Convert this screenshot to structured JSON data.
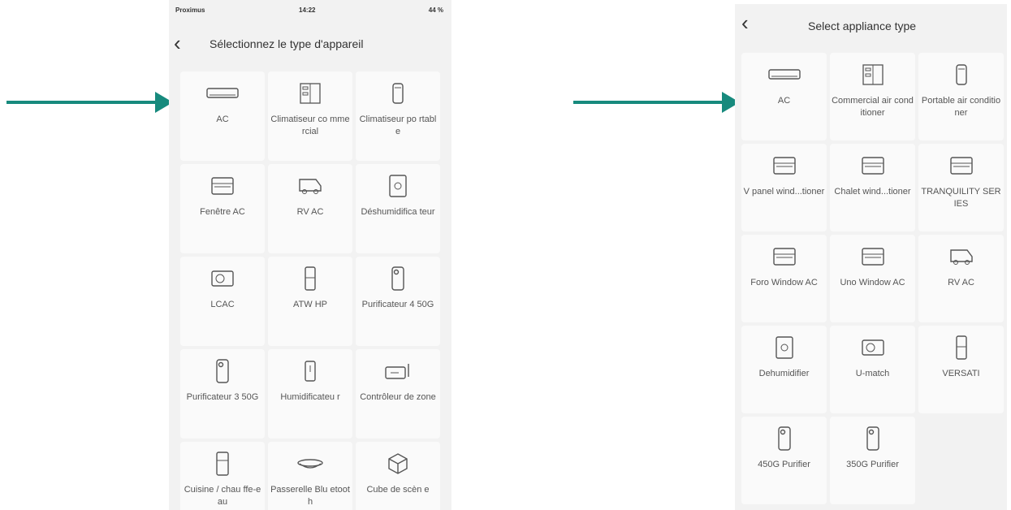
{
  "colors": {
    "arrow": "#178a7d",
    "panel_bg": "#f2f2f2",
    "tile_bg": "#fafafa"
  },
  "left_phone": {
    "status": {
      "carrier": "Proximus",
      "time": "14:22",
      "battery": "44 %"
    },
    "header": {
      "back_icon": "chevron-left-icon",
      "title": "Sélectionnez le type d'appareil"
    },
    "tiles": [
      {
        "icon": "split-ac-icon",
        "label": "AC"
      },
      {
        "icon": "commercial-ac-icon",
        "label": "Climatiseur co mmercial"
      },
      {
        "icon": "portable-ac-icon",
        "label": "Climatiseur po rtable"
      },
      {
        "icon": "window-ac-icon",
        "label": "Fenêtre AC"
      },
      {
        "icon": "rv-ac-icon",
        "label": "RV AC"
      },
      {
        "icon": "dehumidifier-icon",
        "label": "Déshumidifica teur"
      },
      {
        "icon": "lcac-icon",
        "label": "LCAC"
      },
      {
        "icon": "heat-pump-icon",
        "label": "ATW HP"
      },
      {
        "icon": "purifier-icon",
        "label": "Purificateur 4 50G"
      },
      {
        "icon": "purifier-icon",
        "label": "Purificateur 3 50G"
      },
      {
        "icon": "humidifier-icon",
        "label": "Humidificateu r"
      },
      {
        "icon": "zone-controller-icon",
        "label": "Contrôleur de zone"
      },
      {
        "icon": "water-heater-icon",
        "label": "Cuisine / chau ffe-eau"
      },
      {
        "icon": "gateway-icon",
        "label": "Passerelle Blu etooth"
      },
      {
        "icon": "cube-icon",
        "label": "Cube de scèn e"
      }
    ]
  },
  "right_phone": {
    "header": {
      "back_icon": "chevron-left-icon",
      "title": "Select appliance type"
    },
    "tiles": [
      {
        "icon": "split-ac-icon",
        "label": "AC"
      },
      {
        "icon": "commercial-ac-icon",
        "label": "Commercial air conditioner"
      },
      {
        "icon": "portable-ac-icon",
        "label": "Portable air conditioner"
      },
      {
        "icon": "window-ac-icon",
        "label": "V panel wind...tioner"
      },
      {
        "icon": "window-ac-icon",
        "label": "Chalet wind...tioner"
      },
      {
        "icon": "window-ac-icon",
        "label": "TRANQUILITY SERIES"
      },
      {
        "icon": "window-ac-icon",
        "label": "Foro Window AC"
      },
      {
        "icon": "window-ac-icon",
        "label": "Uno Window AC"
      },
      {
        "icon": "rv-ac-icon",
        "label": "RV AC"
      },
      {
        "icon": "dehumidifier-icon",
        "label": "Dehumidifier"
      },
      {
        "icon": "lcac-icon",
        "label": "U-match"
      },
      {
        "icon": "heat-pump-icon",
        "label": "VERSATI"
      },
      {
        "icon": "purifier-icon",
        "label": "450G Purifier"
      },
      {
        "icon": "purifier-icon",
        "label": "350G Purifier"
      }
    ]
  }
}
